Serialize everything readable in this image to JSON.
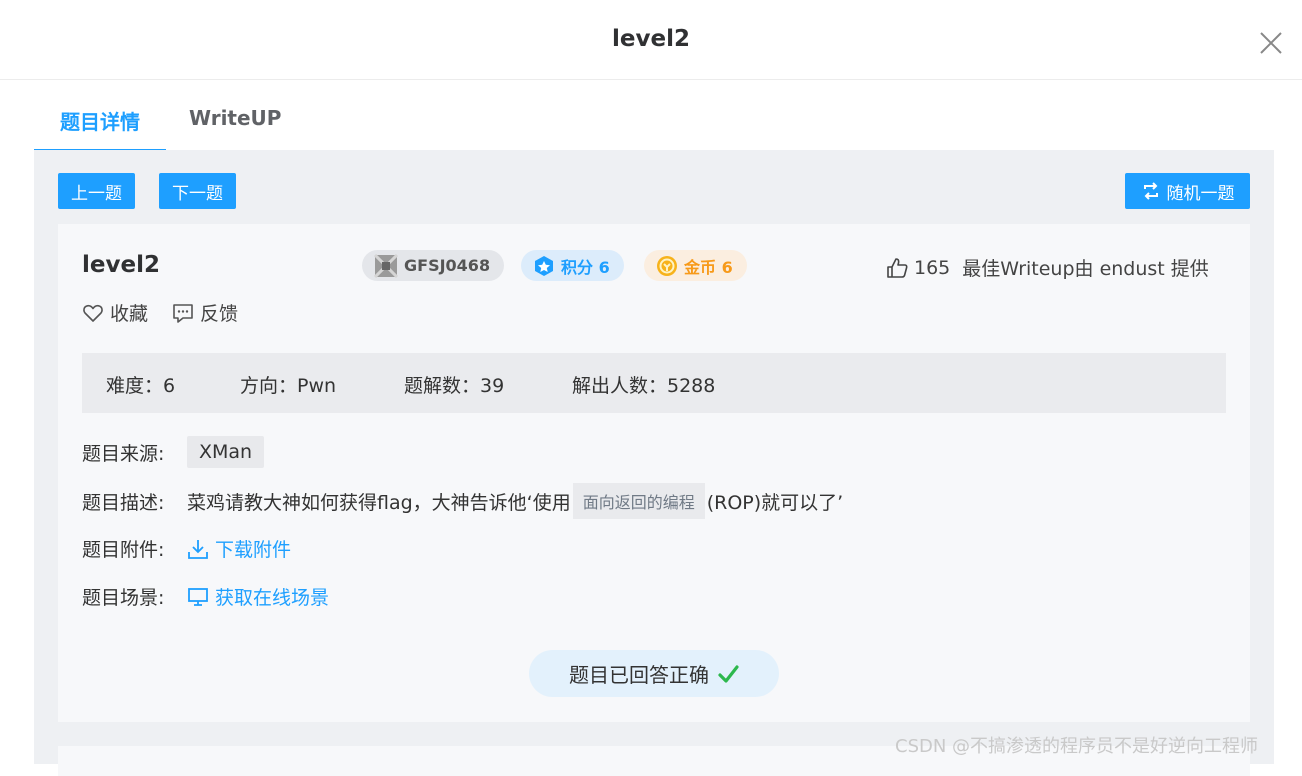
{
  "dialog": {
    "title": "level2"
  },
  "tabs": [
    {
      "label": "题目详情"
    },
    {
      "label": "WriteUP"
    }
  ],
  "nav": {
    "prev_label": "上一题",
    "next_label": "下一题",
    "random_label": "随机一题"
  },
  "challenge": {
    "name": "level2",
    "id_tag": "GFSJ0468",
    "score_tag": "积分 6",
    "gold_tag": "金币 6",
    "likes": "165",
    "writeup_credit": "最佳Writeup由 endust 提供",
    "favorite_label": "收藏",
    "feedback_label": "反馈"
  },
  "stats": {
    "difficulty": "难度：6",
    "direction": "方向：Pwn",
    "solves": "题解数：39",
    "solvers": "解出人数：5288"
  },
  "details": {
    "source_label": "题目来源:",
    "source_value": "XMan",
    "desc_label": "题目描述:",
    "desc_before": "菜鸡请教大神如何获得flag，大神告诉他‘使用",
    "desc_code": "面向返回的编程",
    "desc_after": "(ROP)就可以了’",
    "attach_label": "题目附件:",
    "attach_link": "下载附件",
    "scene_label": "题目场景:",
    "scene_link": "获取在线场景"
  },
  "status": {
    "answered": "题目已回答正确"
  },
  "watermark": "CSDN @不搞渗透的程序员不是好逆向工程师",
  "colors": {
    "accent": "#1e9fff",
    "gold": "#f79a1a",
    "success": "#2db84d"
  }
}
